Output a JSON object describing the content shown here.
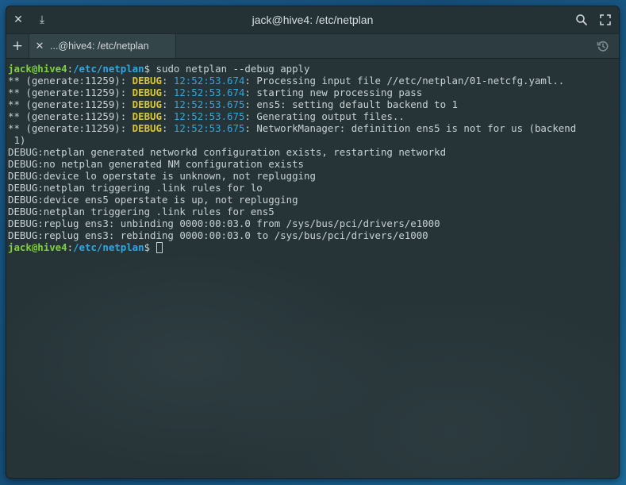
{
  "window": {
    "title": "jack@hive4: /etc/netplan",
    "close_glyph": "✕",
    "download_glyph": "⤓",
    "search_glyph": "⌕",
    "maximize_glyph": "⛶"
  },
  "tabs": {
    "new_glyph": "+",
    "items": [
      {
        "close_glyph": "✕",
        "label": "...@hive4: /etc/netplan"
      }
    ]
  },
  "terminal": {
    "prompt_user": "jack@hive4",
    "prompt_colon": ":",
    "prompt_path": "/etc/netplan",
    "prompt_symbol": "$",
    "command": " sudo netplan --debug apply",
    "generate_lines": [
      {
        "prefix": "** (generate:11259): ",
        "level": "DEBUG",
        "sep1": ": ",
        "time": "12:52:53.674",
        "message": ": Processing input file //etc/netplan/01-netcfg.yaml.."
      },
      {
        "prefix": "** (generate:11259): ",
        "level": "DEBUG",
        "sep1": ": ",
        "time": "12:52:53.674",
        "message": ": starting new processing pass"
      },
      {
        "prefix": "** (generate:11259): ",
        "level": "DEBUG",
        "sep1": ": ",
        "time": "12:52:53.675",
        "message": ": ens5: setting default backend to 1"
      },
      {
        "prefix": "** (generate:11259): ",
        "level": "DEBUG",
        "sep1": ": ",
        "time": "12:52:53.675",
        "message": ": Generating output files.."
      },
      {
        "prefix": "** (generate:11259): ",
        "level": "DEBUG",
        "sep1": ": ",
        "time": "12:52:53.675",
        "message": ": NetworkManager: definition ens5 is not for us (backend"
      }
    ],
    "wrap_line": " 1)",
    "plain_lines": [
      "DEBUG:netplan generated networkd configuration exists, restarting networkd",
      "DEBUG:no netplan generated NM configuration exists",
      "DEBUG:device lo operstate is unknown, not replugging",
      "DEBUG:netplan triggering .link rules for lo",
      "DEBUG:device ens5 operstate is up, not replugging",
      "DEBUG:netplan triggering .link rules for ens5",
      "DEBUG:replug ens3: unbinding 0000:00:03.0 from /sys/bus/pci/drivers/e1000",
      "DEBUG:replug ens3: rebinding 0000:00:03.0 to /sys/bus/pci/drivers/e1000"
    ],
    "prompt2_symbol": "$ "
  }
}
